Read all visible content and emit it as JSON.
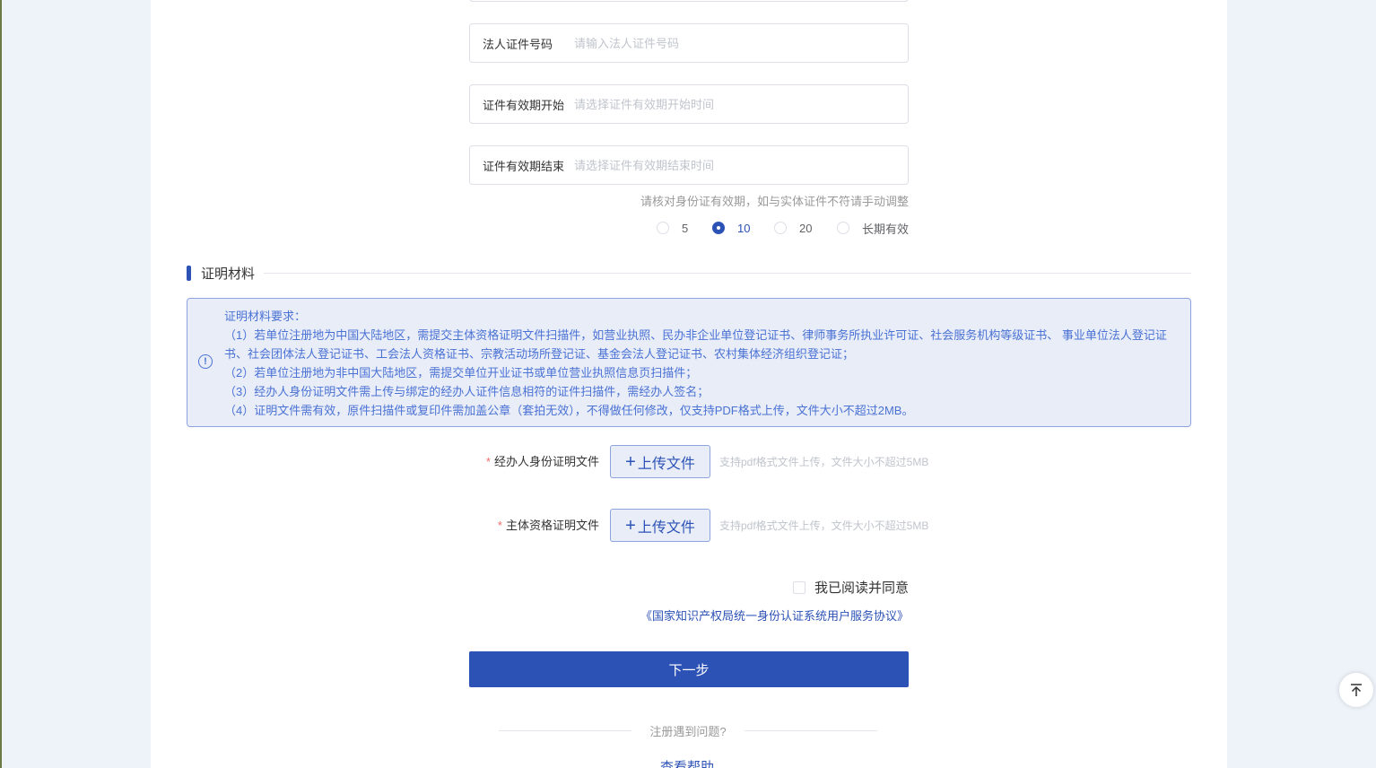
{
  "form": {
    "fields": [
      {
        "label": "法人证件号码",
        "placeholder": "请输入法人证件号码"
      },
      {
        "label": "证件有效期开始",
        "placeholder": "请选择证件有效期开始时间"
      },
      {
        "label": "证件有效期结束",
        "placeholder": "请选择证件有效期结束时间"
      }
    ],
    "validity_hint": "请核对身份证有效期，如与实体证件不符请手动调整",
    "validity_options": [
      {
        "label": "5",
        "checked": false
      },
      {
        "label": "10",
        "checked": true
      },
      {
        "label": "20",
        "checked": false
      },
      {
        "label": "长期有效",
        "checked": false
      }
    ]
  },
  "section": {
    "title": "证明材料"
  },
  "notice": {
    "lines": [
      "证明材料要求：",
      "（1）若单位注册地为中国大陆地区，需提交主体资格证明文件扫描件，如营业执照、民办非企业单位登记证书、律师事务所执业许可证、社会服务机构等级证书、 事业单位法人登记证书、社会团体法人登记证书、工会法人资格证书、宗教活动场所登记证、基金会法人登记证书、农村集体经济组织登记证；",
      "（2）若单位注册地为非中国大陆地区，需提交单位开业证书或单位营业执照信息页扫描件；",
      "（3）经办人身份证明文件需上传与绑定的经办人证件信息相符的证件扫描件，需经办人签名；",
      "（4）证明文件需有效，原件扫描件或复印件需加盖公章（套拍无效），不得做任何修改，仅支持PDF格式上传，文件大小不超过2MB。"
    ],
    "icon": "info-circle-icon"
  },
  "uploads": [
    {
      "required_mark": "*",
      "label": "经办人身份证明文件",
      "plus": "+",
      "button": "上传文件",
      "hint": "支持pdf格式文件上传，文件大小不超过5MB"
    },
    {
      "required_mark": "*",
      "label": "主体资格证明文件",
      "plus": "+",
      "button": "上传文件",
      "hint": "支持pdf格式文件上传，文件大小不超过5MB"
    }
  ],
  "agreement": {
    "checkbox_label": "我已阅读并同意",
    "link_text": "《国家知识产权局统一身份认证系统用户服务协议》"
  },
  "next_button": "下一步",
  "problem": {
    "text": "注册遇到问题?",
    "help_link": "查看帮助"
  },
  "back_to_top_icon": "arrow-up-to-top-icon",
  "colors": {
    "primary": "#2c52b6",
    "notice_bg": "#e8edf8",
    "notice_text": "#4a71d4",
    "page_bg": "#eef3f9"
  }
}
